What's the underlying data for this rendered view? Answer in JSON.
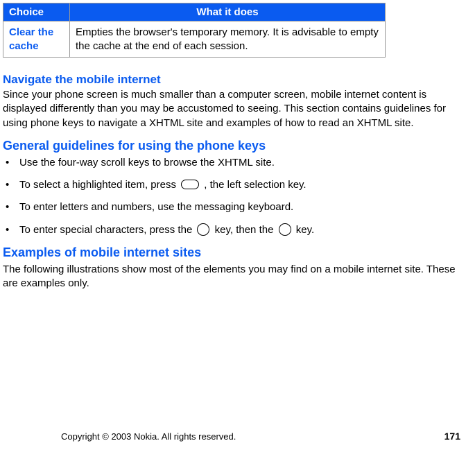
{
  "table": {
    "header": {
      "col1": "Choice",
      "col2": "What it does"
    },
    "row": {
      "choice": "Clear the cache",
      "desc": "Empties the browser's temporary memory. It is advisable to empty the cache at the end of each session."
    }
  },
  "sections": {
    "navigate": {
      "heading": "Navigate the mobile internet",
      "body": "Since your phone screen is much smaller than a computer screen, mobile internet content is displayed differently than you may be accustomed to seeing. This section contains guidelines for using phone keys to navigate a XHTML site and examples of how to read an XHTML site."
    },
    "guidelines": {
      "heading": "General guidelines for using the phone keys",
      "items": [
        "Use the four-way scroll keys to browse the XHTML site.",
        {
          "pre": "To select a highlighted item, press ",
          "post": ", the left selection key."
        },
        "To enter letters and numbers, use the messaging keyboard.",
        {
          "pre": "To enter special characters, press the ",
          "mid": " key, then the ",
          "post": " key."
        }
      ]
    },
    "examples": {
      "heading": "Examples of mobile internet sites",
      "body": "The following illustrations show most of the elements you may find on a mobile internet site. These are examples only."
    }
  },
  "footer": {
    "copyright": "Copyright © 2003 Nokia. All rights reserved.",
    "page": "171"
  }
}
